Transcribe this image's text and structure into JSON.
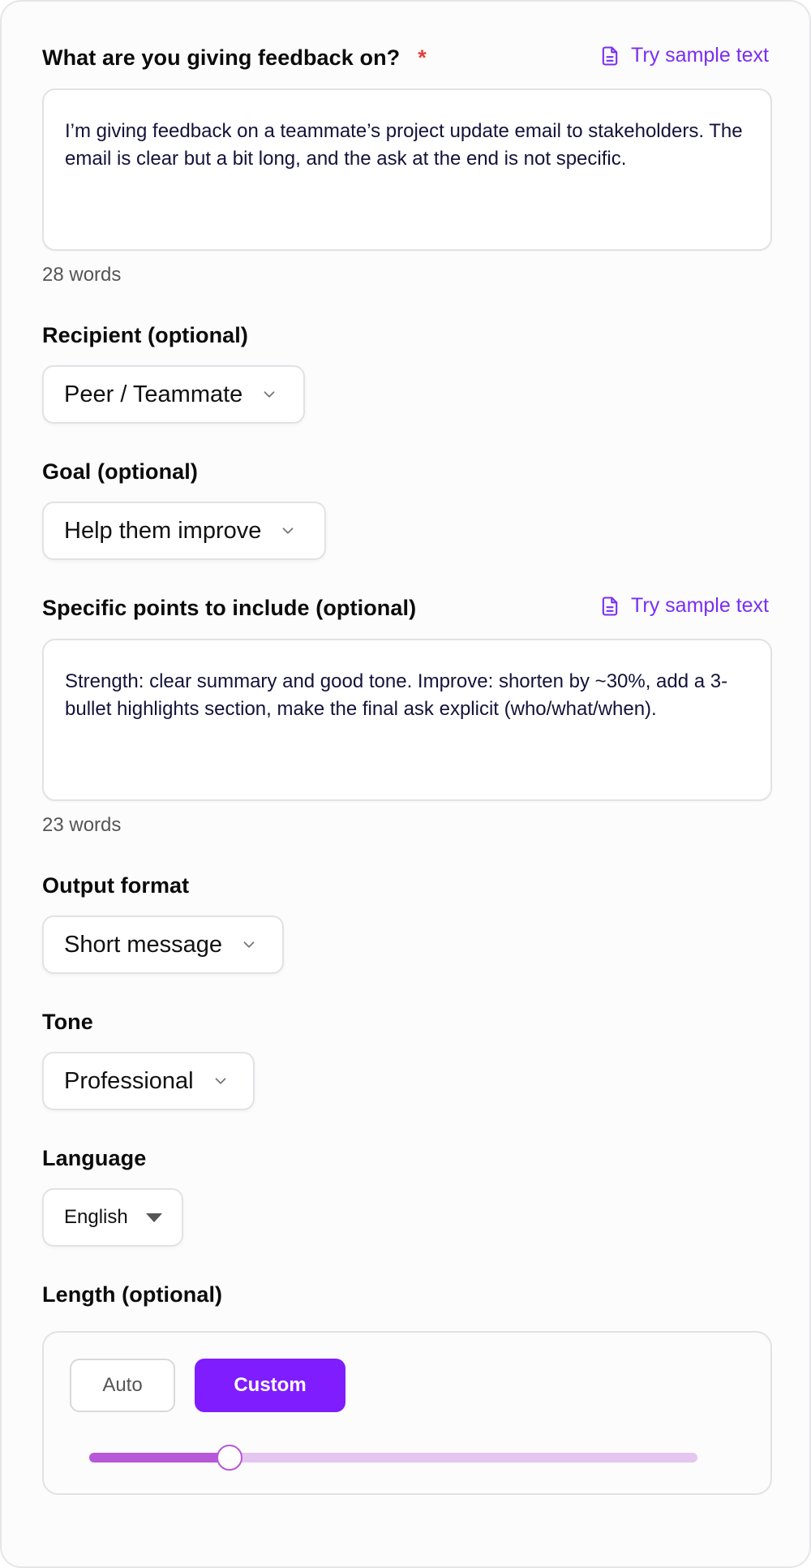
{
  "feedback_on": {
    "label": "What are you giving feedback on?",
    "required_mark": "*",
    "sample_link": "Try sample text",
    "value": "I’m giving feedback on a teammate’s project update email to stakeholders. The email is clear but a bit long, and the ask at the end is not specific.",
    "word_count": "28 words"
  },
  "recipient": {
    "label": "Recipient (optional)",
    "value": "Peer / Teammate"
  },
  "goal": {
    "label": "Goal (optional)",
    "value": "Help them improve"
  },
  "specific_points": {
    "label": "Specific points to include (optional)",
    "sample_link": "Try sample text",
    "value": "Strength: clear summary and good tone. Improve: shorten by ~30%, add a 3-bullet highlights section, make the final ask explicit (who/what/when).",
    "word_count": "23 words"
  },
  "output_format": {
    "label": "Output format",
    "value": "Short message"
  },
  "tone": {
    "label": "Tone",
    "value": "Professional"
  },
  "language": {
    "label": "Language",
    "value": "English"
  },
  "length": {
    "label": "Length (optional)",
    "auto_label": "Auto",
    "custom_label": "Custom",
    "selected": "Custom",
    "slider_fraction": 0.23
  },
  "colors": {
    "accent": "#7f1dff",
    "link": "#7a2ef0",
    "slider_fill": "#b658d8",
    "slider_track": "#e5c6f0",
    "required": "#e0403a"
  }
}
